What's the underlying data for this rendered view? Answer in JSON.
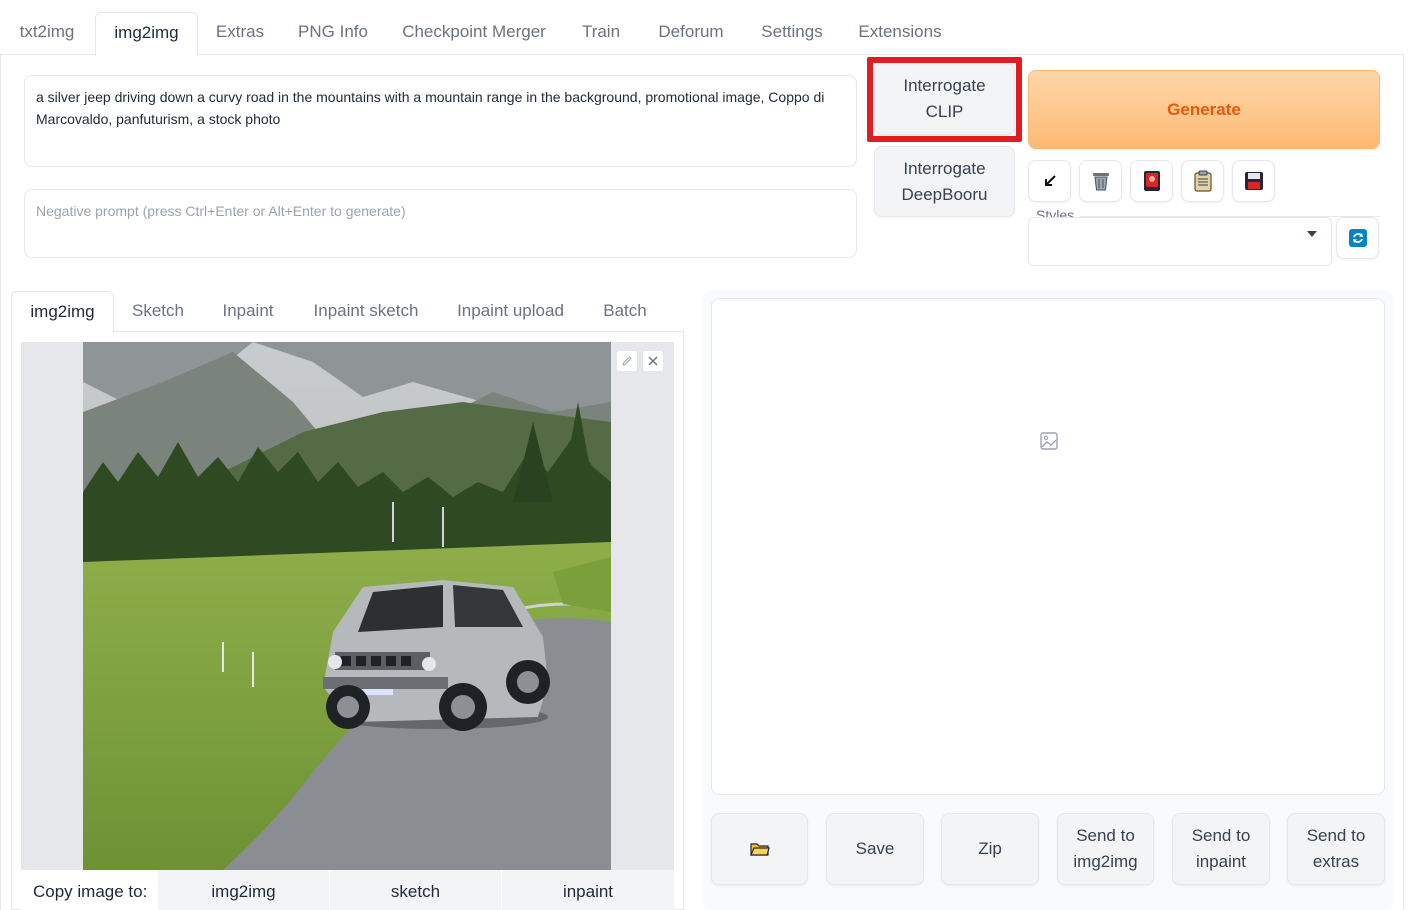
{
  "top_tabs": [
    {
      "label": "txt2img"
    },
    {
      "label": "img2img"
    },
    {
      "label": "Extras"
    },
    {
      "label": "PNG Info"
    },
    {
      "label": "Checkpoint Merger"
    },
    {
      "label": "Train"
    },
    {
      "label": "Deforum"
    },
    {
      "label": "Settings"
    },
    {
      "label": "Extensions"
    }
  ],
  "active_top_tab": "img2img",
  "prompt": {
    "value": "a silver jeep driving down a curvy road in the mountains with a mountain range in the background, promotional image, Coppo di Marcovaldo, panfuturism, a stock photo"
  },
  "negative_prompt": {
    "placeholder": "Negative prompt (press Ctrl+Enter or Alt+Enter to generate)"
  },
  "buttons": {
    "interrogate_clip": "Interrogate CLIP",
    "interrogate_deepbooru": "Interrogate DeepBooru",
    "generate": "Generate"
  },
  "tool_icons": [
    "arrow-down-left-icon",
    "trash-icon",
    "red-card-icon",
    "clipboard-icon",
    "floppy-disk-icon"
  ],
  "styles": {
    "label": "Styles",
    "refresh_icon": "refresh-icon"
  },
  "sub_tabs": [
    {
      "label": "img2img"
    },
    {
      "label": "Sketch"
    },
    {
      "label": "Inpaint"
    },
    {
      "label": "Inpaint sketch"
    },
    {
      "label": "Inpaint upload"
    },
    {
      "label": "Batch"
    }
  ],
  "active_sub_tab": "img2img",
  "copy_image": {
    "label": "Copy image to:",
    "targets": [
      "img2img",
      "sketch",
      "inpaint"
    ]
  },
  "output_buttons": {
    "folder_icon": "folder-icon",
    "save": "Save",
    "zip": "Zip",
    "send_img2img": "Send to img2img",
    "send_inpaint": "Send to inpaint",
    "send_extras": "Send to extras"
  },
  "colors": {
    "highlight": "#e11d24",
    "generate_text": "#ea580c",
    "generate_bg": "#fdba74"
  }
}
